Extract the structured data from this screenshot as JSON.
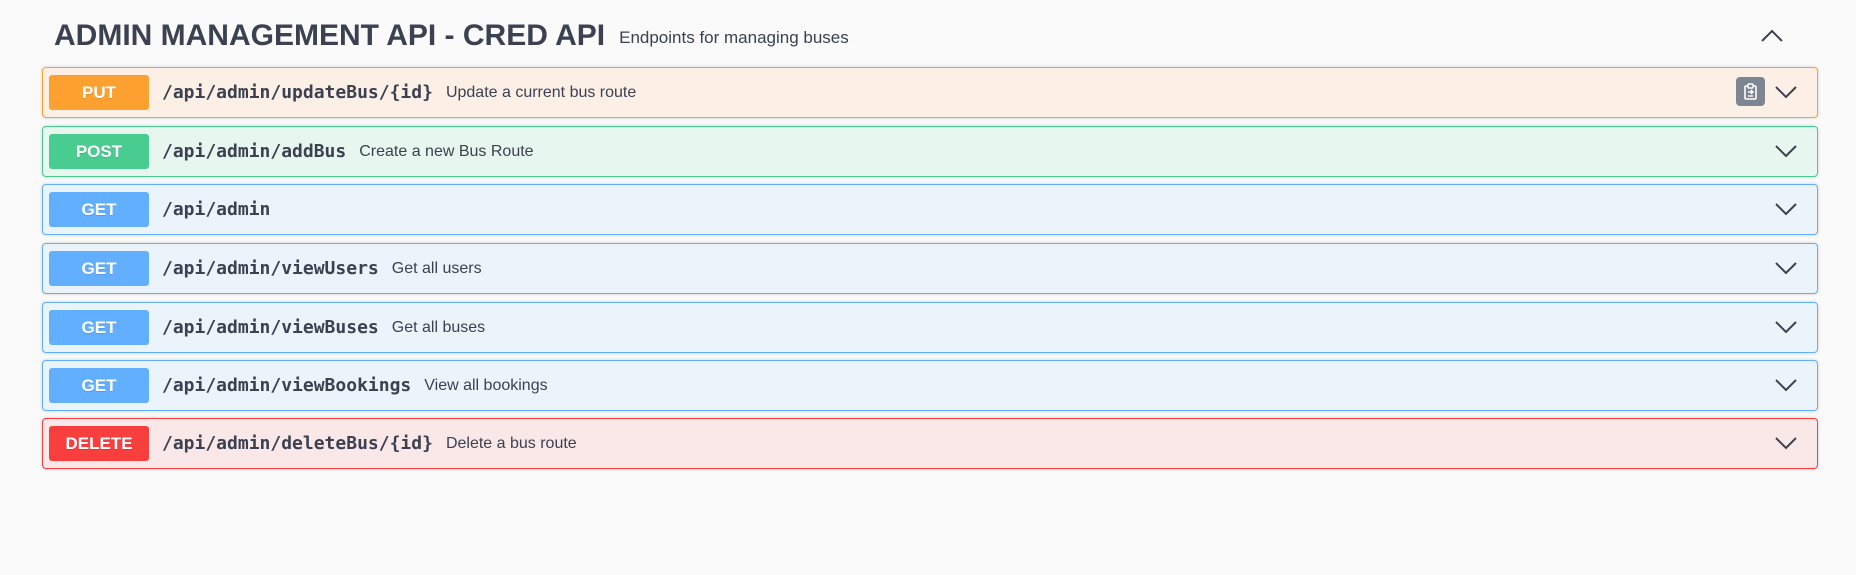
{
  "section": {
    "title": "ADMIN MANAGEMENT API - CRED API",
    "description": "Endpoints for managing buses",
    "toggle_icon": "chevron-up-icon"
  },
  "operations": [
    {
      "method": "PUT",
      "path": "/api/admin/updateBus/{id}",
      "summary": "Update a current bus route",
      "color": "#fca130",
      "has_copy_button": true
    },
    {
      "method": "POST",
      "path": "/api/admin/addBus",
      "summary": "Create a new Bus Route",
      "color": "#49cc90"
    },
    {
      "method": "GET",
      "path": "/api/admin",
      "summary": "",
      "color": "#61affe"
    },
    {
      "method": "GET",
      "path": "/api/admin/viewUsers",
      "summary": "Get all users",
      "color": "#61affe"
    },
    {
      "method": "GET",
      "path": "/api/admin/viewBuses",
      "summary": "Get all buses",
      "color": "#61affe"
    },
    {
      "method": "GET",
      "path": "/api/admin/viewBookings",
      "summary": "View all bookings",
      "color": "#61affe"
    },
    {
      "method": "DELETE",
      "path": "/api/admin/deleteBus/{id}",
      "summary": "Delete a bus route",
      "color": "#f93e3e"
    }
  ],
  "icons": {
    "expand": "chevron-down-icon",
    "copy": "clipboard-copy-icon"
  }
}
